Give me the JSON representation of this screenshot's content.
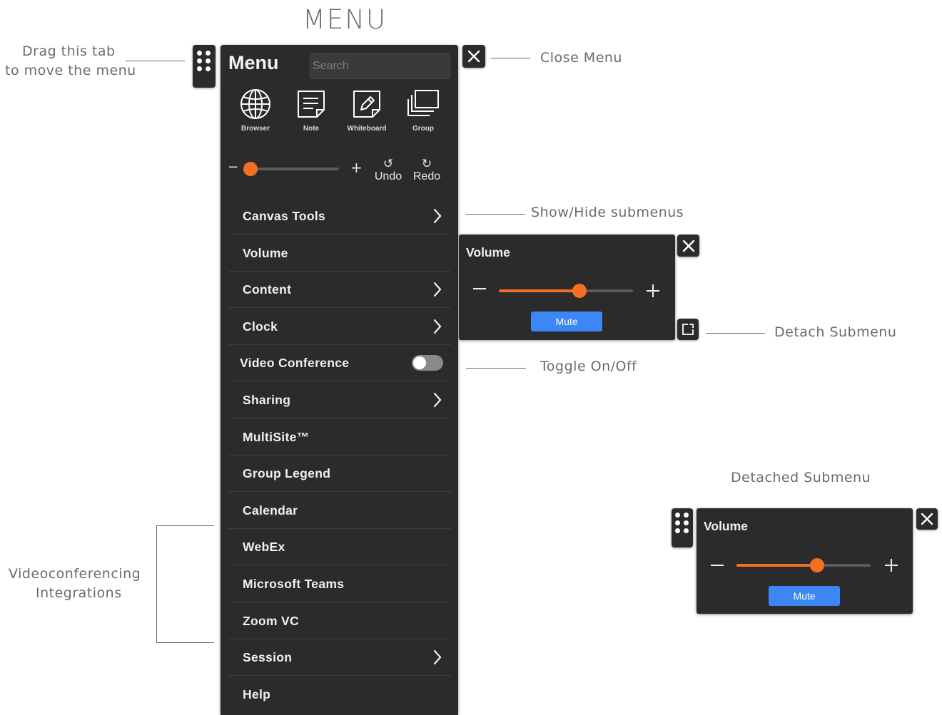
{
  "page": {
    "title": "MENU"
  },
  "annotations": {
    "drag_tab_line1": "Drag this tab",
    "drag_tab_line2": "to move the menu",
    "close_menu": "Close Menu",
    "show_hide": "Show/Hide submenus",
    "detach": "Detach Submenu",
    "toggle": "Toggle On/Off",
    "detached": "Detached Submenu",
    "vc_line1": "Videoconferencing",
    "vc_line2": "Integrations"
  },
  "menu": {
    "title": "Menu",
    "search_placeholder": "Search",
    "tools": [
      {
        "label": "Browser",
        "icon": "globe-icon"
      },
      {
        "label": "Note",
        "icon": "note-icon"
      },
      {
        "label": "Whiteboard",
        "icon": "whiteboard-pen-icon"
      },
      {
        "label": "Group",
        "icon": "group-stack-icon"
      }
    ],
    "size_slider": {
      "minus": "−",
      "plus": "+",
      "level": 0.0
    },
    "undo_label": "Undo",
    "redo_label": "Redo",
    "items": [
      {
        "label": "Canvas Tools",
        "chevron": true
      },
      {
        "label": "Volume",
        "chevron": false
      },
      {
        "label": "Content",
        "chevron": true
      },
      {
        "label": "Clock",
        "chevron": true
      },
      {
        "label": "Video Conference",
        "toggle": false
      },
      {
        "label": "Sharing",
        "chevron": true
      },
      {
        "label": "MultiSite™",
        "chevron": false
      },
      {
        "label": "Group Legend",
        "chevron": false
      },
      {
        "label": "Calendar",
        "chevron": false
      },
      {
        "label": "WebEx",
        "chevron": false
      },
      {
        "label": "Microsoft Teams",
        "chevron": false
      },
      {
        "label": "Zoom VC",
        "chevron": false
      },
      {
        "label": "Session",
        "chevron": true
      },
      {
        "label": "Help",
        "chevron": false
      }
    ]
  },
  "volume_submenu": {
    "title": "Volume",
    "minus": "−",
    "plus": "+",
    "level": 0.6,
    "mute_label": "Mute"
  },
  "detached_submenu": {
    "title": "Volume",
    "minus": "−",
    "plus": "+",
    "level": 0.6,
    "mute_label": "Mute"
  },
  "colors": {
    "panel": "#2b2b2b",
    "accent": "#f36f21",
    "mute_button": "#3d86f5"
  }
}
